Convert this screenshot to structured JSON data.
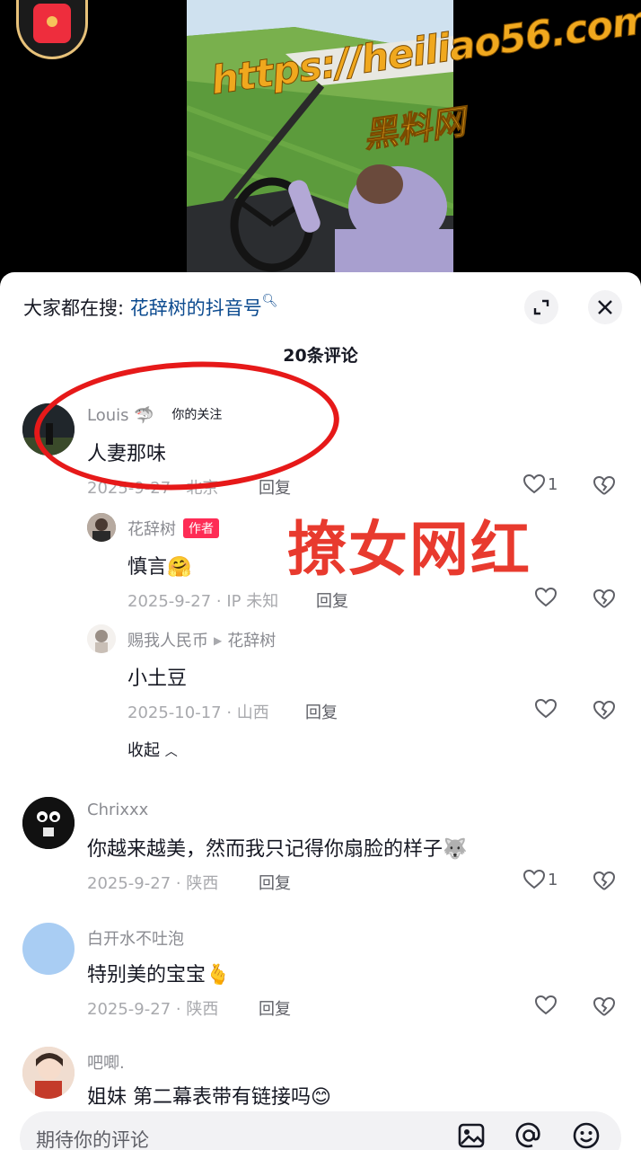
{
  "watermark": {
    "url": "https://heiliao56.com",
    "site_name": "黑料网"
  },
  "panel": {
    "search_prefix": "大家都在搜:",
    "search_keyword": "花辞树的抖音号",
    "comment_count_title": "20条评论",
    "overlay_caption": "撩女网红"
  },
  "comments": [
    {
      "username": "Louis",
      "username_icon": "shark-emoji",
      "tag": "你的关注",
      "text": "人妻那味",
      "meta": "2025-9-27 · 北京",
      "reply": "回复",
      "likes": "1"
    },
    {
      "username": "花辞树",
      "badge": "作者",
      "text": "慎言",
      "text_emoji": "hugging-emoji",
      "meta": "2025-9-27 · IP 未知",
      "reply": "回复",
      "likes": ""
    },
    {
      "username": "赐我人民币",
      "reply_to": "花辞树",
      "text": "小土豆",
      "meta": "2025-10-17 · 山西",
      "reply": "回复",
      "likes": ""
    },
    {
      "username": "Chrixxx",
      "text": "你越来越美，然而我只记得你扇脸的样子",
      "text_emoji": "husky-emoji",
      "meta": "2025-9-27 · 陕西",
      "reply": "回复",
      "likes": "1"
    },
    {
      "username": "白开水不吐泡",
      "text": "特别美的宝宝",
      "text_emoji": "finger-heart-emoji",
      "meta": "2025-9-27 · 陕西",
      "reply": "回复",
      "likes": ""
    },
    {
      "username": "吧唧.",
      "text": "姐妹 第二幕表带有链接吗",
      "text_emoji": "smile-emoji"
    }
  ],
  "collapse_label": "收起",
  "input": {
    "placeholder": "期待你的评论"
  },
  "colors": {
    "accent_red": "#fe2c55",
    "link_blue": "#0b4a8f",
    "overlay_red": "#e83a2e",
    "watermark_orange": "#f0a81e"
  }
}
